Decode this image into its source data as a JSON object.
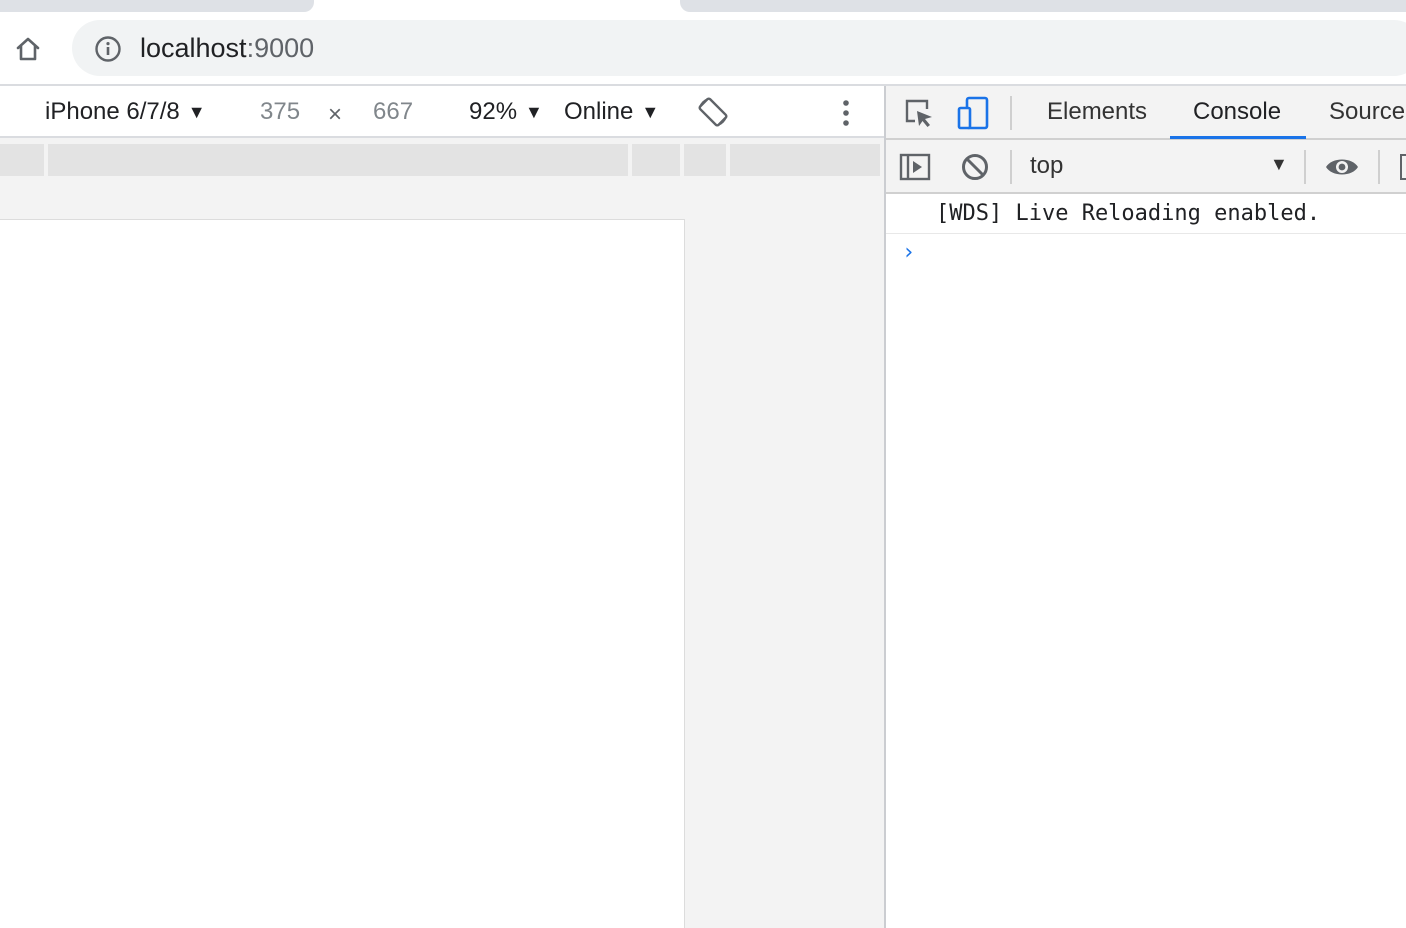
{
  "browser": {
    "omnibox": {
      "url_host": "localhost",
      "url_port": ":9000",
      "icons": {
        "home": "home-icon",
        "info": "info-icon"
      }
    }
  },
  "device_toolbar": {
    "device_label": "iPhone 6/7/8",
    "width_value": "375",
    "times_symbol": "×",
    "height_value": "667",
    "zoom_label": "92%",
    "throttle_label": "Online",
    "dropdown_glyph": "▼",
    "icons": {
      "rotate": "rotate-icon",
      "more": "more-vert-icon"
    }
  },
  "devtools": {
    "tabs": [
      {
        "label": "Elements"
      },
      {
        "label": "Console",
        "active": true
      },
      {
        "label": "Source"
      }
    ],
    "icons": {
      "inspect": "inspect-element-icon",
      "device": "device-toggle-icon"
    },
    "console_toolbar": {
      "context_label": "top",
      "icons": {
        "sidebar": "show-sidebar-icon",
        "clear": "clear-console-icon",
        "eye": "live-expression-icon"
      }
    },
    "console": {
      "messages": [
        {
          "text": "[WDS] Live Reloading enabled."
        }
      ],
      "prompt_glyph": "›"
    }
  },
  "colors": {
    "accent": "#1a73e8",
    "panel_bg": "#f3f3f3",
    "omnibox_bg": "#f1f3f4"
  }
}
